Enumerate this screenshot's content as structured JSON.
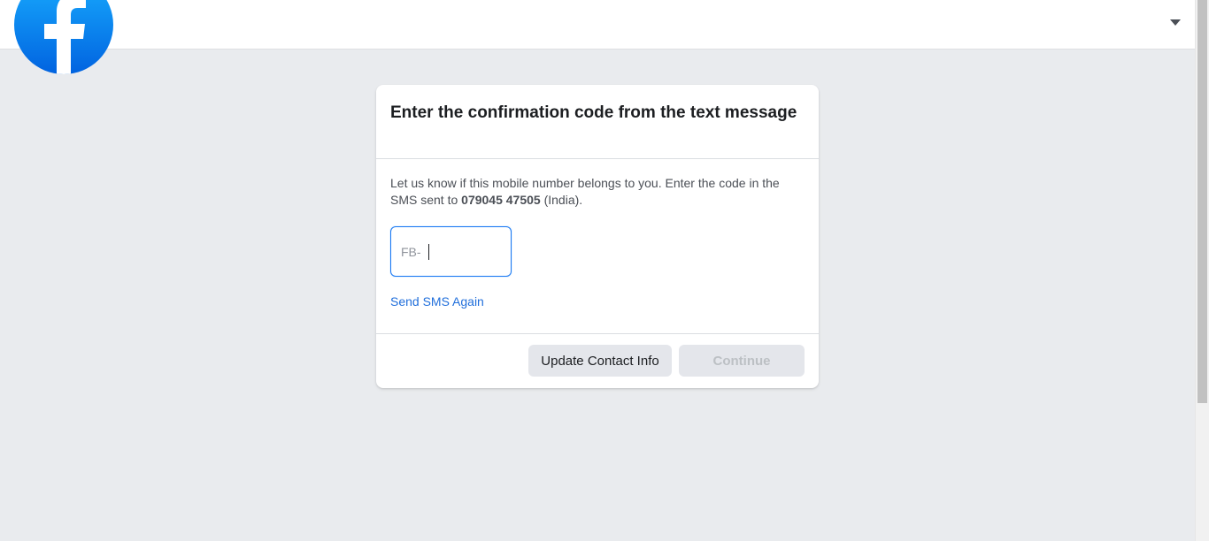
{
  "header": {
    "logo_icon": "facebook-logo-icon",
    "menu_icon": "caret-down-icon"
  },
  "colors": {
    "brand": "#1877f2",
    "link": "#216fdb",
    "background": "#e9ebee"
  },
  "card": {
    "title": "Enter the confirmation code from the text message",
    "description_before": "Let us know if this mobile number belongs to you. Enter the code in the SMS sent to ",
    "phone": "079045 47505",
    "description_after": " (India).",
    "code_prefix": "FB-",
    "code_value": "",
    "resend_link": "Send SMS Again",
    "update_button": "Update Contact Info",
    "continue_button": "Continue"
  }
}
